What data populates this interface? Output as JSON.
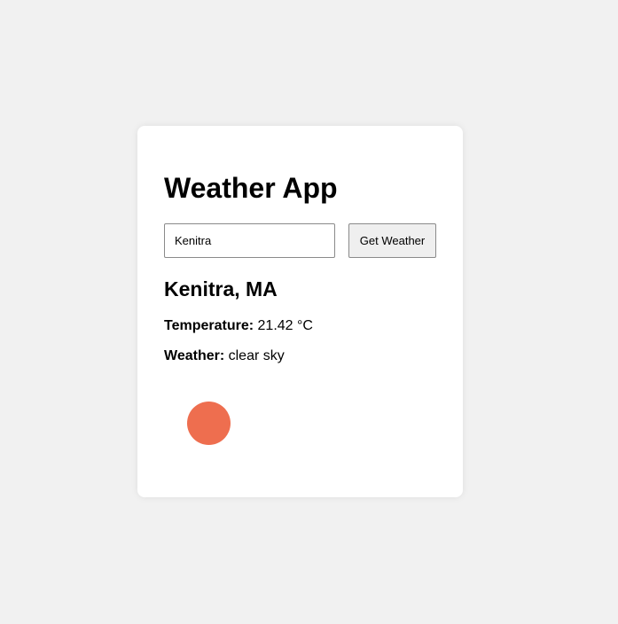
{
  "app": {
    "title": "Weather App"
  },
  "search": {
    "value": "Kenitra",
    "button_label": "Get Weather"
  },
  "result": {
    "location": "Kenitra, MA",
    "temperature_label": "Temperature:",
    "temperature_value": "21.42 °C",
    "weather_label": "Weather:",
    "weather_value": "clear sky",
    "icon_name": "clear-sky-sun-icon",
    "icon_color": "#ee6e4f"
  },
  "colors": {
    "page_background": "#f1f1f1",
    "card_background": "#ffffff"
  }
}
